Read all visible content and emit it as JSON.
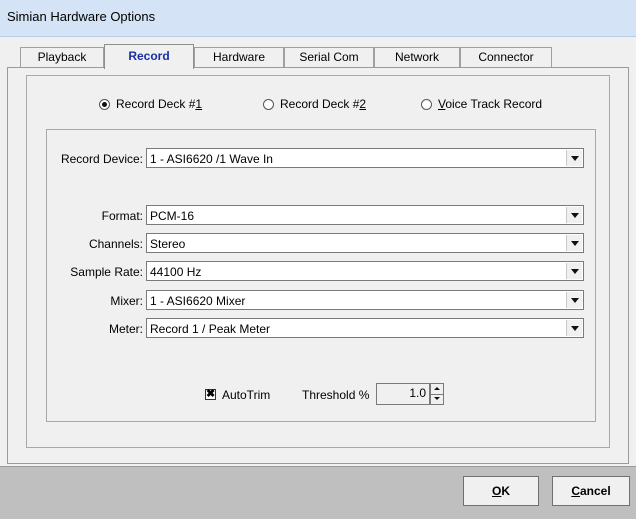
{
  "window": {
    "title": "Simian Hardware Options"
  },
  "tabs": [
    {
      "label": "Playback"
    },
    {
      "label": "Record"
    },
    {
      "label": "Hardware"
    },
    {
      "label": "Serial Com"
    },
    {
      "label": "Network"
    },
    {
      "label": "Connector"
    }
  ],
  "radios": {
    "deck1": {
      "prefix": "Record Deck #",
      "underline": "1",
      "selected": true
    },
    "deck2": {
      "prefix": "Record Deck #",
      "underline": "2",
      "selected": false
    },
    "voice": {
      "underline": "V",
      "suffix": "oice Track Record",
      "selected": false
    }
  },
  "fields": {
    "record_device": {
      "label": "Record Device:",
      "value": "1 - ASI6620 /1 Wave In"
    },
    "format": {
      "label": "Format:",
      "value": "PCM-16"
    },
    "channels": {
      "label": "Channels:",
      "value": "Stereo"
    },
    "sample_rate": {
      "label": "Sample Rate:",
      "value": "44100 Hz"
    },
    "mixer": {
      "label": "Mixer:",
      "value": "1 - ASI6620 Mixer"
    },
    "meter": {
      "label": "Meter:",
      "value": "Record 1 / Peak Meter"
    }
  },
  "autotrim": {
    "label": "AutoTrim",
    "checked": true,
    "mark": "✖"
  },
  "threshold": {
    "label": "Threshold %",
    "value": "1.0"
  },
  "buttons": {
    "ok": {
      "underline": "O",
      "rest": "K"
    },
    "cancel": {
      "underline": "C",
      "rest": "ancel"
    }
  }
}
